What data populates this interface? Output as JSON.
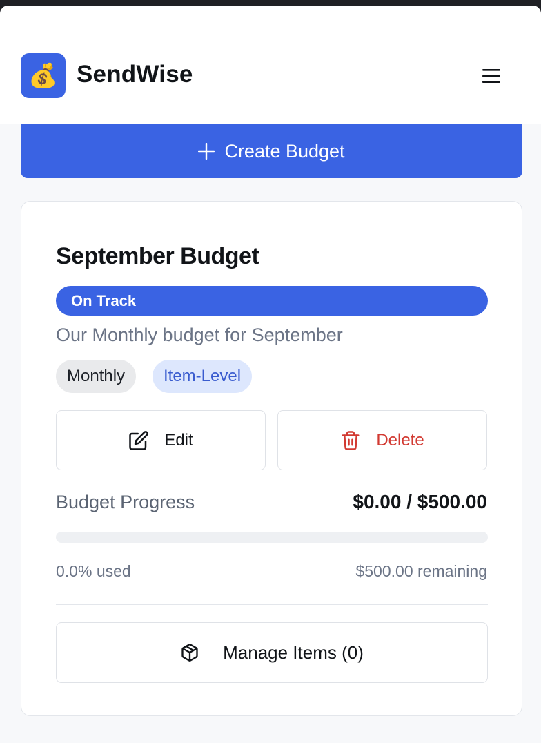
{
  "header": {
    "brand": "SendWise",
    "logo_icon": "money-bag-icon",
    "logo_glyph": "💰",
    "menu_icon": "hamburger-menu-icon"
  },
  "create_button": {
    "label": "Create Budget",
    "icon": "plus-icon"
  },
  "budget": {
    "title": "September Budget",
    "status": "On Track",
    "description": "Our Monthly budget for September",
    "tags": [
      "Monthly",
      "Item-Level"
    ],
    "edit_label": "Edit",
    "delete_label": "Delete",
    "progress_label": "Budget Progress",
    "progress_value": "$0.00 / $500.00",
    "progress_fraction": 0.0,
    "used_text": "0.0% used",
    "remaining_text": "$500.00 remaining",
    "manage_label": "Manage Items (0)"
  },
  "colors": {
    "accent": "#3a63e3",
    "danger": "#d23a32",
    "tag_item_bg": "#dde7fd",
    "tag_monthly_bg": "#e9eaec"
  }
}
